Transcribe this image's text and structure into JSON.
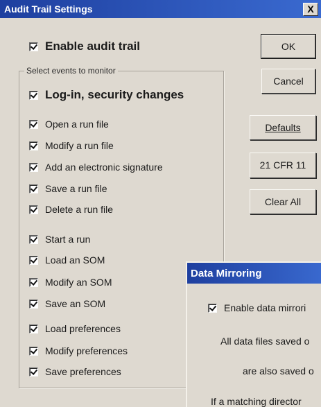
{
  "dialog": {
    "title": "Audit Trail Settings",
    "close_label": "X",
    "enable_audit_trail": "Enable audit trail",
    "group_label": "Select events to monitor",
    "login_security": "Log-in, security changes",
    "events": [
      "Open a run file",
      "Modify a run file",
      "Add an electronic signature",
      "Save a run file",
      "Delete a run file",
      "Start a run",
      "Load an SOM",
      "Modify an SOM",
      "Save an SOM",
      "Load preferences",
      "Modify preferences",
      "Save preferences"
    ],
    "buttons": {
      "ok": "OK",
      "cancel": "Cancel",
      "defaults": "Defaults",
      "cfr": "21 CFR 11",
      "clear_all": "Clear All"
    }
  },
  "data_mirroring": {
    "title": "Data Mirroring",
    "enable": "Enable data mirrori",
    "line1": "All data files saved o",
    "line2": "are also saved o",
    "line3": "If a matching director"
  }
}
